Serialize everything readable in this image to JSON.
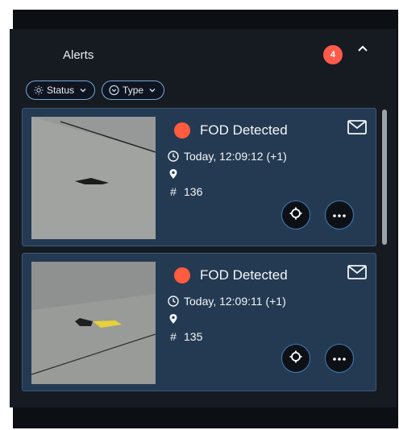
{
  "panel": {
    "title": "Alerts",
    "badge": "4"
  },
  "filters": [
    {
      "label": "Status"
    },
    {
      "label": "Type"
    }
  ],
  "alerts": [
    {
      "title": "FOD Detected",
      "time": "Today, 12:09:12 (+1)",
      "number": "136"
    },
    {
      "title": "FOD Detected",
      "time": "Today, 12:09:11 (+1)",
      "number": "135"
    }
  ],
  "colors": {
    "badge": "#ff5a4a",
    "status_dot": "#ff5b3f",
    "card_bg": "#243a52",
    "accent": "#3f7fb8"
  }
}
